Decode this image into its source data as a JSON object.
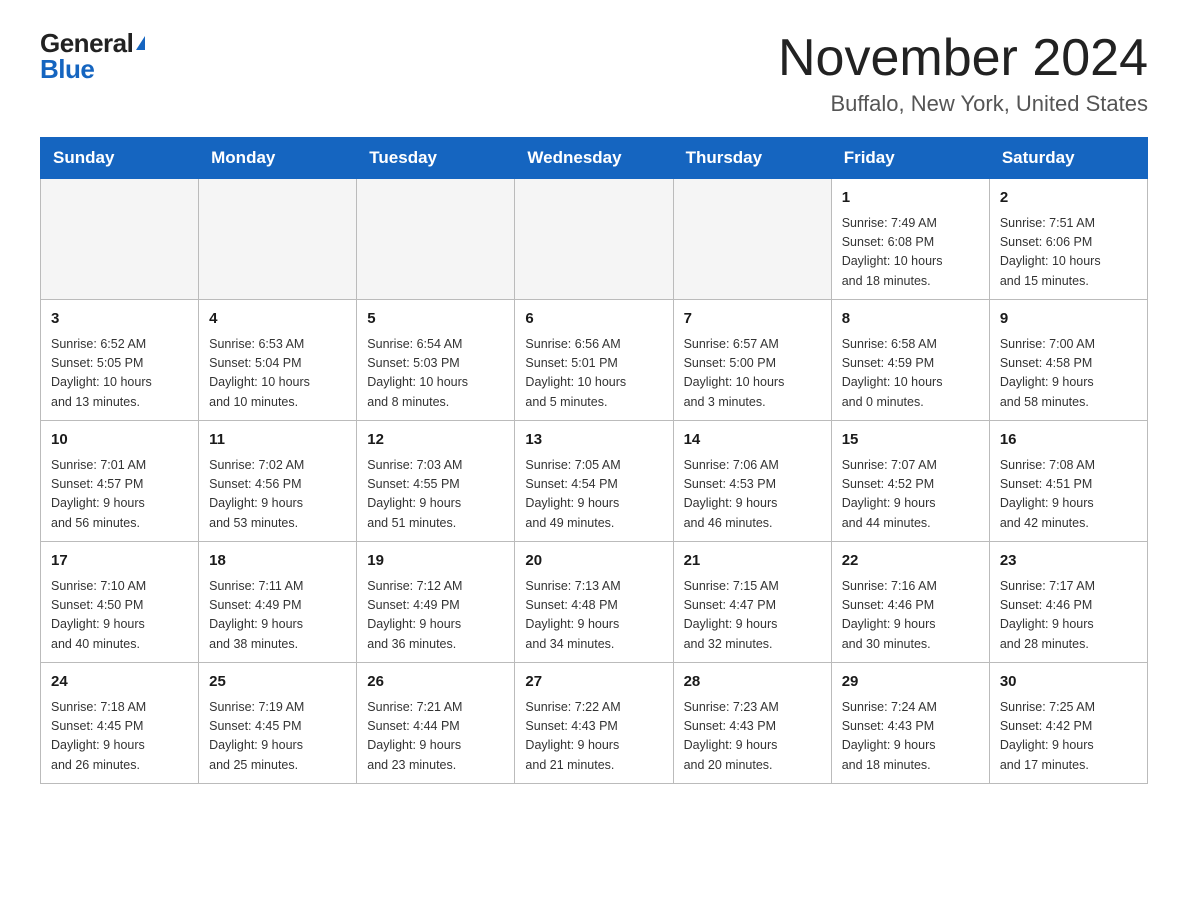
{
  "header": {
    "logo_general": "General",
    "logo_blue": "Blue",
    "month_title": "November 2024",
    "location": "Buffalo, New York, United States"
  },
  "days_of_week": [
    "Sunday",
    "Monday",
    "Tuesday",
    "Wednesday",
    "Thursday",
    "Friday",
    "Saturday"
  ],
  "weeks": [
    [
      {
        "day": "",
        "info": ""
      },
      {
        "day": "",
        "info": ""
      },
      {
        "day": "",
        "info": ""
      },
      {
        "day": "",
        "info": ""
      },
      {
        "day": "",
        "info": ""
      },
      {
        "day": "1",
        "info": "Sunrise: 7:49 AM\nSunset: 6:08 PM\nDaylight: 10 hours\nand 18 minutes."
      },
      {
        "day": "2",
        "info": "Sunrise: 7:51 AM\nSunset: 6:06 PM\nDaylight: 10 hours\nand 15 minutes."
      }
    ],
    [
      {
        "day": "3",
        "info": "Sunrise: 6:52 AM\nSunset: 5:05 PM\nDaylight: 10 hours\nand 13 minutes."
      },
      {
        "day": "4",
        "info": "Sunrise: 6:53 AM\nSunset: 5:04 PM\nDaylight: 10 hours\nand 10 minutes."
      },
      {
        "day": "5",
        "info": "Sunrise: 6:54 AM\nSunset: 5:03 PM\nDaylight: 10 hours\nand 8 minutes."
      },
      {
        "day": "6",
        "info": "Sunrise: 6:56 AM\nSunset: 5:01 PM\nDaylight: 10 hours\nand 5 minutes."
      },
      {
        "day": "7",
        "info": "Sunrise: 6:57 AM\nSunset: 5:00 PM\nDaylight: 10 hours\nand 3 minutes."
      },
      {
        "day": "8",
        "info": "Sunrise: 6:58 AM\nSunset: 4:59 PM\nDaylight: 10 hours\nand 0 minutes."
      },
      {
        "day": "9",
        "info": "Sunrise: 7:00 AM\nSunset: 4:58 PM\nDaylight: 9 hours\nand 58 minutes."
      }
    ],
    [
      {
        "day": "10",
        "info": "Sunrise: 7:01 AM\nSunset: 4:57 PM\nDaylight: 9 hours\nand 56 minutes."
      },
      {
        "day": "11",
        "info": "Sunrise: 7:02 AM\nSunset: 4:56 PM\nDaylight: 9 hours\nand 53 minutes."
      },
      {
        "day": "12",
        "info": "Sunrise: 7:03 AM\nSunset: 4:55 PM\nDaylight: 9 hours\nand 51 minutes."
      },
      {
        "day": "13",
        "info": "Sunrise: 7:05 AM\nSunset: 4:54 PM\nDaylight: 9 hours\nand 49 minutes."
      },
      {
        "day": "14",
        "info": "Sunrise: 7:06 AM\nSunset: 4:53 PM\nDaylight: 9 hours\nand 46 minutes."
      },
      {
        "day": "15",
        "info": "Sunrise: 7:07 AM\nSunset: 4:52 PM\nDaylight: 9 hours\nand 44 minutes."
      },
      {
        "day": "16",
        "info": "Sunrise: 7:08 AM\nSunset: 4:51 PM\nDaylight: 9 hours\nand 42 minutes."
      }
    ],
    [
      {
        "day": "17",
        "info": "Sunrise: 7:10 AM\nSunset: 4:50 PM\nDaylight: 9 hours\nand 40 minutes."
      },
      {
        "day": "18",
        "info": "Sunrise: 7:11 AM\nSunset: 4:49 PM\nDaylight: 9 hours\nand 38 minutes."
      },
      {
        "day": "19",
        "info": "Sunrise: 7:12 AM\nSunset: 4:49 PM\nDaylight: 9 hours\nand 36 minutes."
      },
      {
        "day": "20",
        "info": "Sunrise: 7:13 AM\nSunset: 4:48 PM\nDaylight: 9 hours\nand 34 minutes."
      },
      {
        "day": "21",
        "info": "Sunrise: 7:15 AM\nSunset: 4:47 PM\nDaylight: 9 hours\nand 32 minutes."
      },
      {
        "day": "22",
        "info": "Sunrise: 7:16 AM\nSunset: 4:46 PM\nDaylight: 9 hours\nand 30 minutes."
      },
      {
        "day": "23",
        "info": "Sunrise: 7:17 AM\nSunset: 4:46 PM\nDaylight: 9 hours\nand 28 minutes."
      }
    ],
    [
      {
        "day": "24",
        "info": "Sunrise: 7:18 AM\nSunset: 4:45 PM\nDaylight: 9 hours\nand 26 minutes."
      },
      {
        "day": "25",
        "info": "Sunrise: 7:19 AM\nSunset: 4:45 PM\nDaylight: 9 hours\nand 25 minutes."
      },
      {
        "day": "26",
        "info": "Sunrise: 7:21 AM\nSunset: 4:44 PM\nDaylight: 9 hours\nand 23 minutes."
      },
      {
        "day": "27",
        "info": "Sunrise: 7:22 AM\nSunset: 4:43 PM\nDaylight: 9 hours\nand 21 minutes."
      },
      {
        "day": "28",
        "info": "Sunrise: 7:23 AM\nSunset: 4:43 PM\nDaylight: 9 hours\nand 20 minutes."
      },
      {
        "day": "29",
        "info": "Sunrise: 7:24 AM\nSunset: 4:43 PM\nDaylight: 9 hours\nand 18 minutes."
      },
      {
        "day": "30",
        "info": "Sunrise: 7:25 AM\nSunset: 4:42 PM\nDaylight: 9 hours\nand 17 minutes."
      }
    ]
  ]
}
